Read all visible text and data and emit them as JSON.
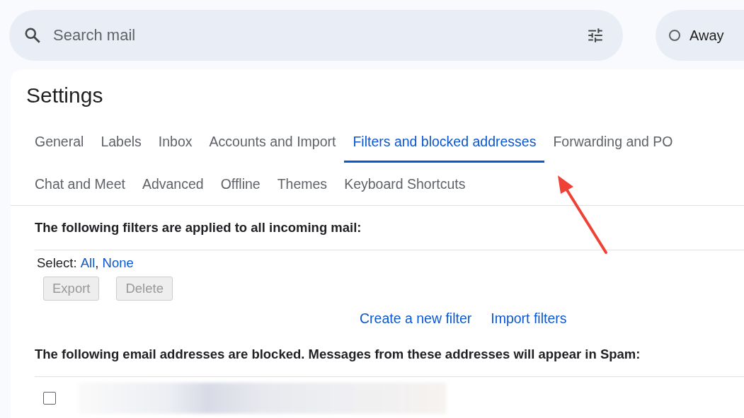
{
  "search": {
    "placeholder": "Search mail"
  },
  "status": {
    "label": "Away"
  },
  "settings": {
    "title": "Settings",
    "tab_rows": [
      [
        {
          "label": "General",
          "selected": false
        },
        {
          "label": "Labels",
          "selected": false
        },
        {
          "label": "Inbox",
          "selected": false
        },
        {
          "label": "Accounts and Import",
          "selected": false
        },
        {
          "label": "Filters and blocked addresses",
          "selected": true
        },
        {
          "label": "Forwarding and PO",
          "selected": false
        }
      ],
      [
        {
          "label": "Chat and Meet",
          "selected": false
        },
        {
          "label": "Advanced",
          "selected": false
        },
        {
          "label": "Offline",
          "selected": false
        },
        {
          "label": "Themes",
          "selected": false
        },
        {
          "label": "Keyboard Shortcuts",
          "selected": false
        }
      ]
    ],
    "filters": {
      "heading": "The following filters are applied to all incoming mail:",
      "select_label": "Select:",
      "select_links": [
        "All",
        "None"
      ],
      "select_separator": ",",
      "buttons": [
        {
          "label": "Export",
          "disabled": true
        },
        {
          "label": "Delete",
          "disabled": true
        }
      ],
      "links": [
        "Create a new filter",
        "Import filters"
      ]
    },
    "blocked": {
      "heading": "The following email addresses are blocked. Messages from these addresses will appear in Spam:",
      "rows": [
        {
          "checked": false
        }
      ]
    }
  }
}
